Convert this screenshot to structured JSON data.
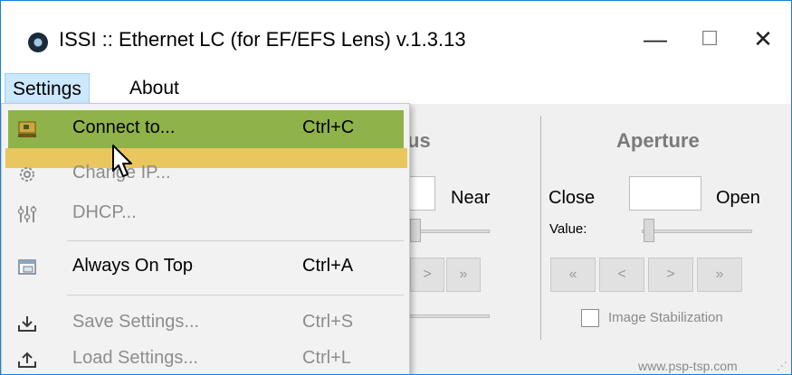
{
  "window": {
    "title": "ISSI :: Ethernet LC (for EF/EFS Lens) v.1.3.13",
    "controls": {
      "minimize": "—",
      "maximize": "☐",
      "close": "✕"
    }
  },
  "menubar": {
    "settings": "Settings",
    "about": "About"
  },
  "settings_menu": {
    "items": [
      {
        "label": "Connect to...",
        "shortcut": "Ctrl+C",
        "icon": "connect-icon",
        "enabled": true,
        "highlighted": true
      },
      {
        "label": "Change IP...",
        "shortcut": "",
        "icon": "gear-icon",
        "enabled": false
      },
      {
        "label": "DHCP...",
        "shortcut": "",
        "icon": "network-icon",
        "enabled": false
      },
      {
        "label": "Always On Top",
        "shortcut": "Ctrl+A",
        "icon": "window-icon",
        "enabled": true
      },
      {
        "label": "Save Settings...",
        "shortcut": "Ctrl+S",
        "icon": "save-icon",
        "enabled": false
      },
      {
        "label": "Load Settings...",
        "shortcut": "Ctrl+L",
        "icon": "load-icon",
        "enabled": false
      }
    ]
  },
  "focus_panel": {
    "title_fragment": "us",
    "near_label": "Near",
    "nav_buttons": [
      ">",
      "»"
    ]
  },
  "aperture_panel": {
    "title": "Aperture",
    "close_label": "Close",
    "open_label": "Open",
    "value_label": "Value:",
    "nav_buttons": [
      "«",
      "<",
      ">",
      "»"
    ],
    "image_stabilization_label": "Image Stabilization"
  },
  "footer": {
    "link": "www.psp-tsp.com"
  },
  "colors": {
    "highlight": "#8fb24a",
    "highlight_glow": "#e8c14e",
    "menu_hover": "#cce8ff",
    "window_border": "#1a7fd4"
  }
}
